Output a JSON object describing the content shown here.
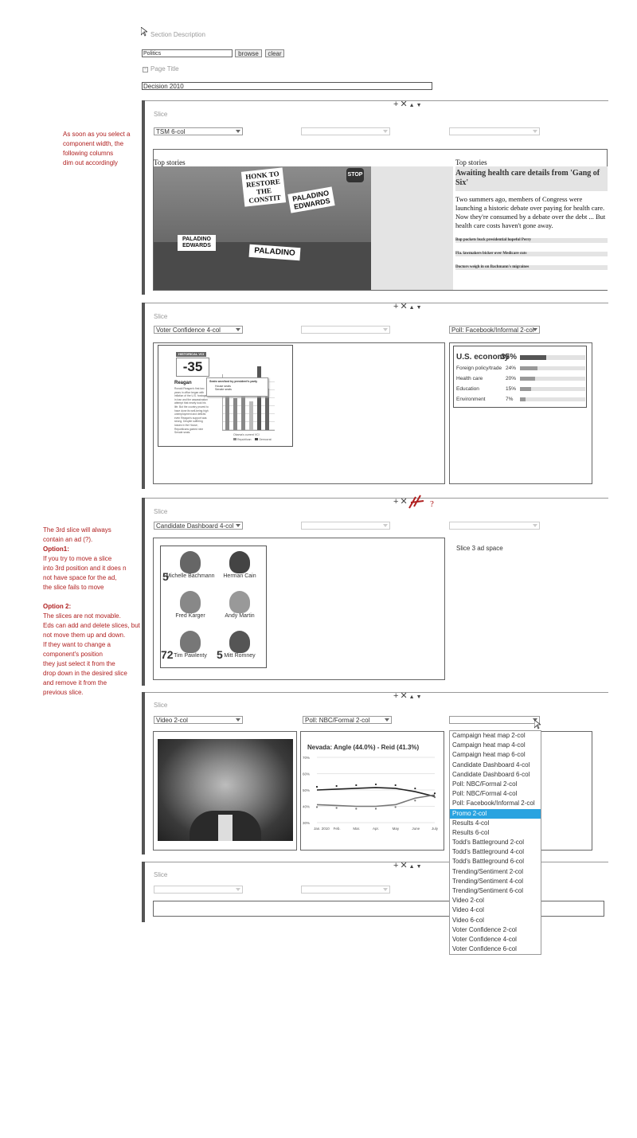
{
  "header": {
    "section_desc_label": "Section Description",
    "section_value": "Politics",
    "browse_label": "browse",
    "clear_label": "clear",
    "page_title_label": "Page Title",
    "page_title_value": "Decision 2010"
  },
  "controls": {
    "add": "+",
    "delete": "✕",
    "up": "▲",
    "down": "▼"
  },
  "notes": {
    "note1": [
      "As soon as you select a",
      "component width, the",
      "following columns",
      "dim out accordingly"
    ],
    "note2_intro": [
      "The 3rd slice will always",
      "contain an ad (?)."
    ],
    "option1_title": "Option1:",
    "option1": [
      "If you try to move a slice",
      "into 3rd position and it does n",
      "not have space for the ad,",
      "the slice fails to move"
    ],
    "option2_title": "Option 2:",
    "option2": [
      "The slices are not movable.",
      "Eds can add and delete slices, but",
      "not move them up and down.",
      "If they want to change a",
      "component's position",
      "they just select it  from the",
      "drop down in the desired slice",
      "and remove it from the",
      "previous slice."
    ],
    "handwritten": "??"
  },
  "slice_label": "Slice",
  "slice1": {
    "col1": "TSM 6-col",
    "left_heading": "Top stories",
    "right_heading": "Top stories",
    "headline": "Awaiting health care details from 'Gang of Six'",
    "body": "Two summers ago, members of Congress were launching a historic debate over paying for health care. Now they're consumed by a debate over the debt ... But health care costs haven't gone away.",
    "links": [
      "Bop pockets buck presidential hopeful Perry",
      "Fla. lawmakers bicker over Medicare cuts",
      "Doctors weigh in on Bachmann's migraines"
    ],
    "signs": [
      "HONK TO RESTORE THE CONSTIT",
      "PALADINO EDWARDS",
      "PALADINO",
      "PALADINO EDWARDS",
      "STOP"
    ]
  },
  "slice2": {
    "col1": "Voter Confidence 4-col",
    "col3": "Poll: Facebook/Informal 2-col",
    "vci": {
      "tag": "HISTORICAL VCI",
      "value": "-35",
      "name": "Reagan",
      "text": "Ronald Reagan's first two years in office began with inflation of the U.S. hostages in Iran and the assassination attempt that nearly took his life. But the country proved to have done its well-being high unemployment and deficits even Reagan's support was strong. Despite suffering losses in the House, Republicans gained nine Senate seats.",
      "popup": "Seats won/lost by president's party",
      "popup_rows": [
        "House seats",
        "Senate seats"
      ],
      "legend": [
        "Republican",
        "Democrat"
      ],
      "current": "Obama's current VCI"
    },
    "poll": {
      "rows": [
        {
          "label": "U.S. economy",
          "pct": "35%",
          "value": 35
        },
        {
          "label": "Foreign policy/trade",
          "pct": "24%",
          "value": 24
        },
        {
          "label": "Health care",
          "pct": "20%",
          "value": 20
        },
        {
          "label": "Education",
          "pct": "15%",
          "value": 15
        },
        {
          "label": "Environment",
          "pct": "7%",
          "value": 7
        }
      ]
    }
  },
  "slice3": {
    "col1": "Candidate Dashboard 4-col",
    "ad_text": "Slice 3 ad space",
    "candidates": [
      {
        "num": "5",
        "name": "Michelle Bachmann"
      },
      {
        "num": "",
        "name": "Herman Cain"
      },
      {
        "num": "",
        "name": "Fred Karger"
      },
      {
        "num": "",
        "name": "Andy Martin"
      },
      {
        "num": "72",
        "name": "Tim Pawlenty"
      },
      {
        "num": "5",
        "name": "Mitt Romney"
      }
    ]
  },
  "slice4": {
    "col1": "Video 2-col",
    "col2": "Poll: NBC/Formal 2-col",
    "chart_title": "Nevada: Angle (44.0%) - Reid (41.3%)",
    "dropdown": [
      "Campaign heat map 2-col",
      "Campaign heat map 4-col",
      "Campaign heat map 6-col",
      "Candidate Dashboard 4-col",
      "Candidate Dashboard 6-col",
      "Poll: NBC/Formal 2-col",
      "Poll: NBC/Formal 4-col",
      "Poll: Facebook/Informal 2-col",
      "Promo 2-col",
      "Results 4-col",
      "Results 6-col",
      "Todd's Battleground 2-col",
      "Todd's Battleground 4-col",
      "Todd's Battleground 6-col",
      "Trending/Sentiment 2-col",
      "Trending/Sentiment 4-col",
      "Trending/Sentiment 6-col",
      "Video 2-col",
      "Video 4-col",
      "Video 6-col",
      "Voter Confidence 2-col",
      "Voter Confidence 4-col",
      "Voter Confidence 6-col"
    ],
    "dropdown_highlight": 8
  },
  "chart_data": {
    "type": "line",
    "title": "Nevada: Angle (44.0%) - Reid (41.3%)",
    "categories": [
      "Jan. 2010",
      "Feb.",
      "Mar.",
      "Apr.",
      "May",
      "June",
      "July"
    ],
    "ylim": [
      30,
      70
    ],
    "yticks": [
      "70%",
      "60%",
      "50%",
      "40%",
      "30%"
    ],
    "series": [
      {
        "name": "Angle",
        "values": [
          50,
          50.5,
          51,
          51.5,
          51,
          49,
          46
        ],
        "color": "#222"
      },
      {
        "name": "Reid",
        "values": [
          41,
          40.5,
          40,
          40,
          41,
          45,
          47
        ],
        "color": "#777"
      }
    ]
  }
}
